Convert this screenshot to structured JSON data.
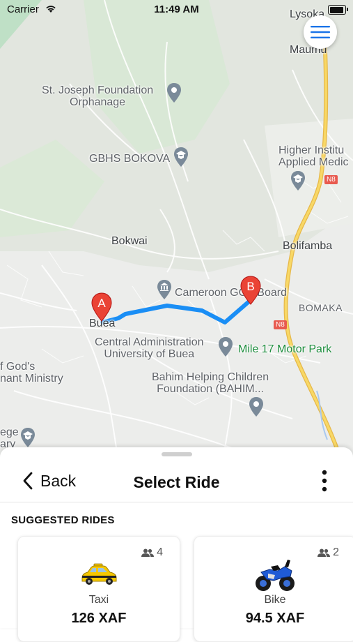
{
  "status": {
    "carrier": "Carrier",
    "time": "11:49 AM",
    "battery_level": 1.0
  },
  "map": {
    "labels": {
      "lysoka": "Lysoka",
      "maumu": "Maumu",
      "st_joseph": "St. Joseph Foundation\nOrphanage",
      "gbhs": "GBHS BOKOVA",
      "higher_inst": "Higher Institu\nApplied Medic",
      "bokwai": "Bokwai",
      "bolifamba": "Bolifamba",
      "cameroon_gcb": "Cameroon GCE Board",
      "bomaka": "BOMAKA",
      "buea": "Buea",
      "central_admin": "Central Administration\nUniversity of Buea",
      "mile17": "Mile 17 Motor Park",
      "gods_ministry": "f God's\nnant Ministry",
      "bahim": "Bahim Helping Children\nFoundation (BAHIM...",
      "ege": "ege\nary",
      "n8_top": "N8",
      "n8_mid": "N8"
    },
    "marker_a": "A",
    "marker_b": "B",
    "colors": {
      "route": "#1a8ef5",
      "marker": "#ea4335",
      "highway": "#f6c444",
      "water": "#a9c9f0",
      "green": "#c9e5cf"
    }
  },
  "menu_button": {
    "icon": "hamburger-icon",
    "color": "#1a73e8"
  },
  "sheet": {
    "back_label": "Back",
    "title": "Select Ride",
    "more_icon": "more-vertical-icon",
    "section_title": "SUGGESTED RIDES",
    "rides": [
      {
        "name": "Taxi",
        "price": "126 XAF",
        "capacity": "4",
        "icon": "taxi-icon"
      },
      {
        "name": "Bike",
        "price": "94.5 XAF",
        "capacity": "2",
        "icon": "motorbike-icon"
      }
    ]
  }
}
